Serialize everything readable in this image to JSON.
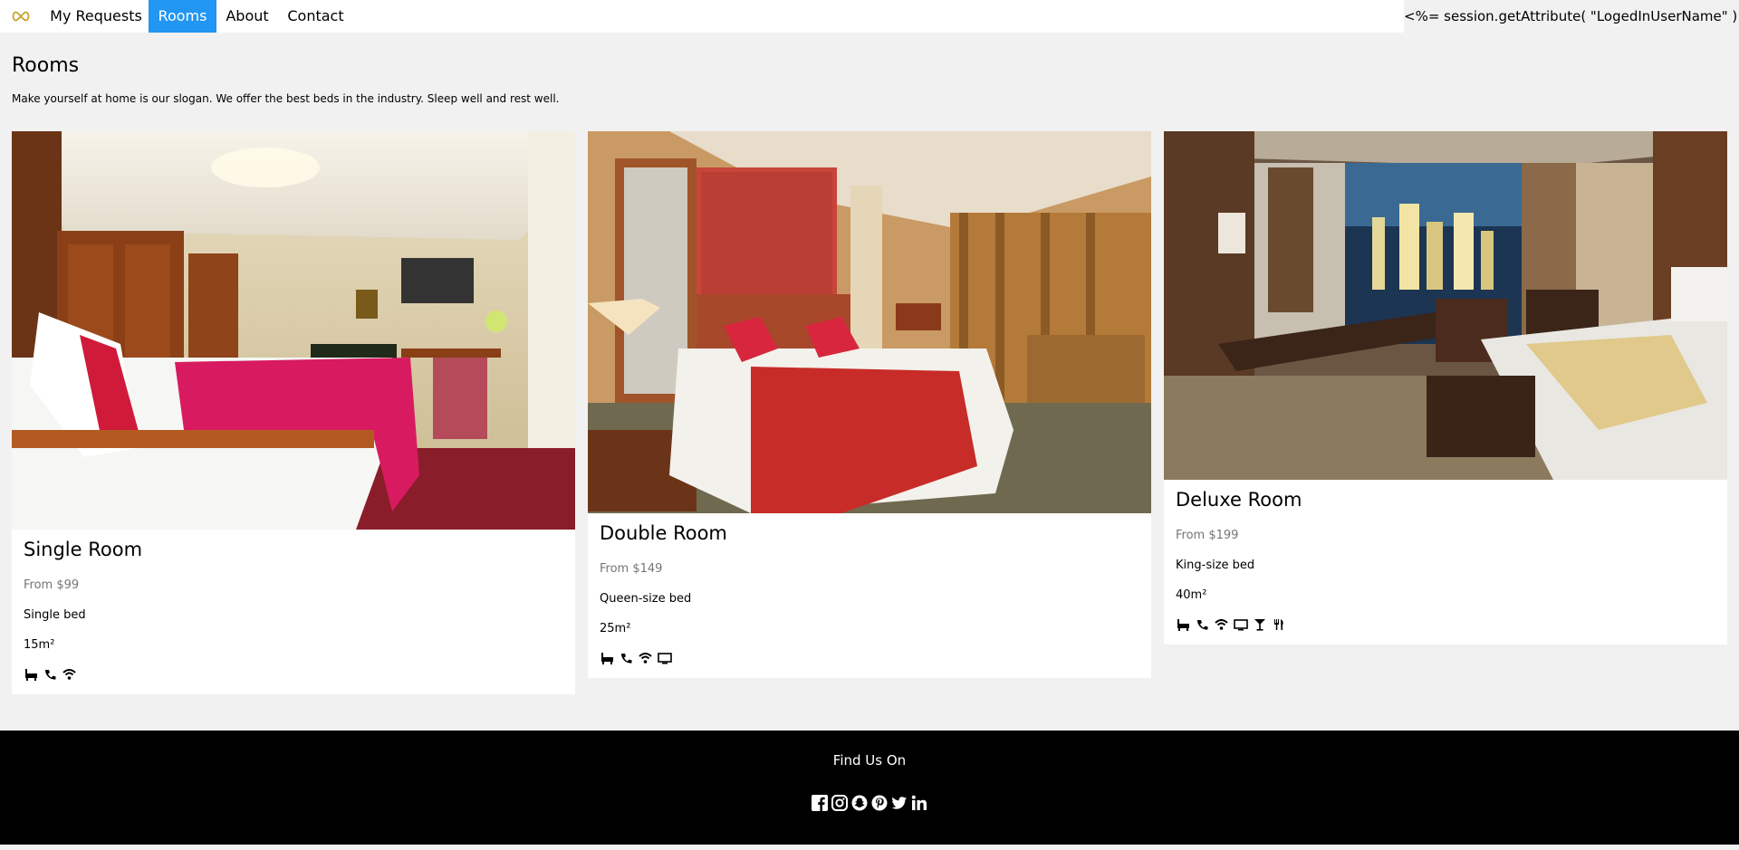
{
  "nav": {
    "logo_icon": "infinity-logo-icon",
    "items": [
      {
        "label": "My Requests",
        "active": false
      },
      {
        "label": "Rooms",
        "active": true
      },
      {
        "label": "About",
        "active": false
      },
      {
        "label": "Contact",
        "active": false
      }
    ],
    "user_text": "<%= session.getAttribute( \"LogedInUserName\" ) %>",
    "active_color": "#2196F3"
  },
  "page": {
    "title": "Rooms",
    "subtitle": "Make yourself at home is our slogan. We offer the best beds in the industry. Sleep well and rest well."
  },
  "rooms": [
    {
      "name": "Single Room",
      "price": "From $99",
      "bed": "Single bed",
      "size": "15m²",
      "amenities": [
        "bathtub-icon",
        "phone-icon",
        "wifi-icon"
      ]
    },
    {
      "name": "Double Room",
      "price": "From $149",
      "bed": "Queen-size bed",
      "size": "25m²",
      "amenities": [
        "bathtub-icon",
        "phone-icon",
        "wifi-icon",
        "tv-icon"
      ]
    },
    {
      "name": "Deluxe Room",
      "price": "From $199",
      "bed": "King-size bed",
      "size": "40m²",
      "amenities": [
        "bathtub-icon",
        "phone-icon",
        "wifi-icon",
        "tv-icon",
        "cocktail-icon",
        "cutlery-icon"
      ]
    }
  ],
  "footer": {
    "title": "Find Us On",
    "socials": [
      "facebook-icon",
      "instagram-icon",
      "snapchat-icon",
      "pinterest-icon",
      "twitter-icon",
      "linkedin-icon"
    ]
  }
}
